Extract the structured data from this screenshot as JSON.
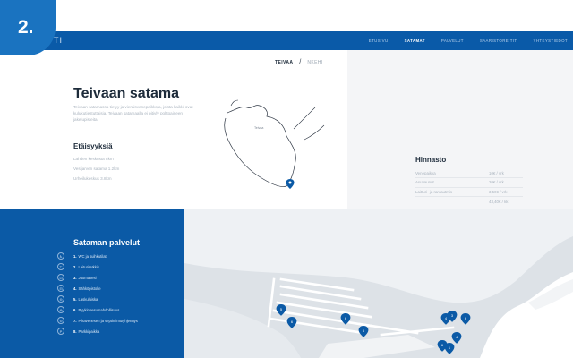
{
  "step_badge": "2.",
  "header": {
    "logo": "TI",
    "nav": [
      "Etusivu",
      "Satamat",
      "Palvelut",
      "Saaristoreitit",
      "Yhteystiedot"
    ],
    "active_index": 1
  },
  "lang": {
    "active": "TEIVAA",
    "inactive": "NKEHI",
    "separator": "/"
  },
  "hero": {
    "title": "Teivaan satama",
    "intro": "Teivaan satamassa tietyy ja vieraisvenepaikkoja, joista kaikki ovat kulukutiestuttaisia. Teivaan satamaalla ei pitiyly polttoaineen jakelupisteita.",
    "map_label": "Teivaa"
  },
  "distances": {
    "heading": "Etäisyyksiä",
    "items": [
      "Lahden keskusta 8km",
      "Vesijarven satama 1.2km",
      "Urheilukeskus 3.8km"
    ]
  },
  "pricing": {
    "heading": "Hinnasto",
    "rows": [
      {
        "label": "Venepaikka",
        "value": "10€ / vrk"
      },
      {
        "label": "Asuvaunut",
        "value": "20€ / vrk"
      },
      {
        "label": "Laitturi- ja rantautmis",
        "value": "3,50€ / vrk"
      },
      {
        "label": "",
        "value": "43,40€ / kk"
      },
      {
        "label": "",
        "value": "80,00€ / kausi"
      }
    ]
  },
  "services": {
    "title": "Sataman palvelut",
    "items": [
      {
        "icon": "wc-icon",
        "glyph": "♿",
        "num": "1.",
        "label": "WC ja suihkutilat"
      },
      {
        "icon": "tap-icon",
        "glyph": "⊤",
        "num": "2.",
        "label": "Laituriratkkis"
      },
      {
        "icon": "fuel-icon",
        "glyph": "⊡",
        "num": "3.",
        "label": "Juomavesi"
      },
      {
        "icon": "plug-icon",
        "glyph": "⊟",
        "num": "4.",
        "label": "Sähköpistoke"
      },
      {
        "icon": "trash-icon",
        "glyph": "⊖",
        "num": "5.",
        "label": "Laskuluiska"
      },
      {
        "icon": "recycle-icon",
        "glyph": "⊗",
        "num": "6.",
        "label": "Pyykinpesumahdollisuus"
      },
      {
        "icon": "boat-icon",
        "glyph": "⊝",
        "num": "7.",
        "label": "Pikavenesen ja septin imutyhjennys"
      },
      {
        "icon": "parking-icon",
        "glyph": "P",
        "num": "8.",
        "label": "Parkkipaikka"
      }
    ]
  },
  "harbour_pins": [
    "5",
    "6",
    "6",
    "6",
    "4",
    "3",
    "6",
    "4",
    "6",
    "1"
  ],
  "colors": {
    "brand": "#0b5aa6",
    "accent": "#1a73c0",
    "topbar": "#0a5aa8"
  }
}
